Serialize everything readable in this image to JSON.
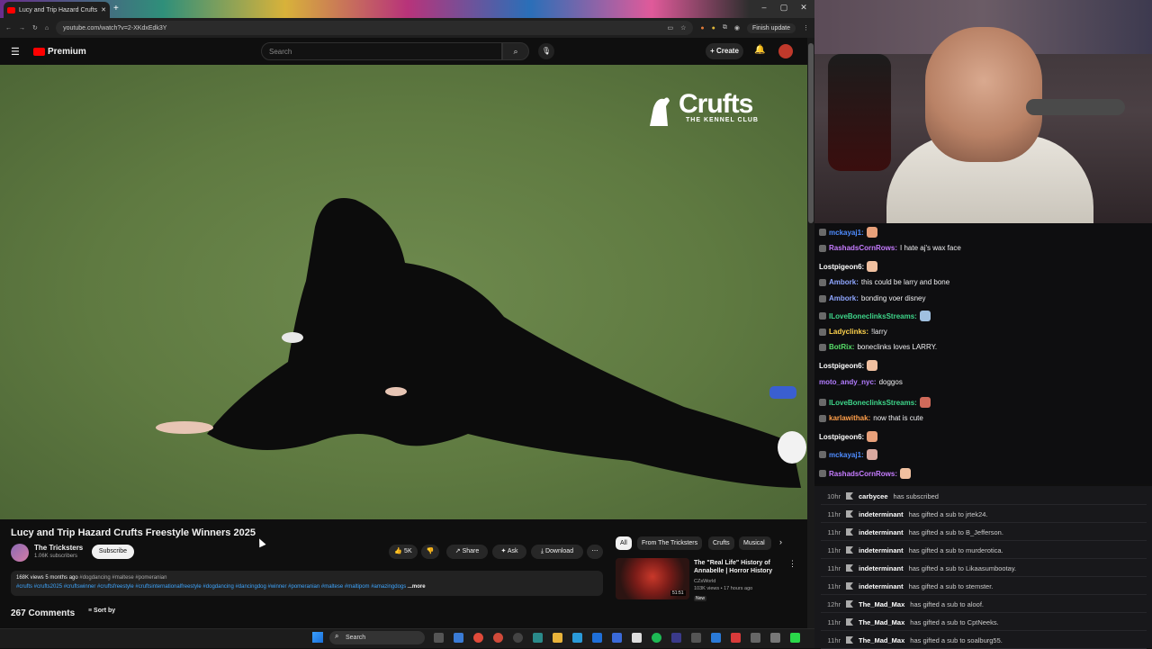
{
  "browser": {
    "tab_title": "Lucy and Trip Hazard Crufts",
    "url": "youtube.com/watch?v=2-XKdxEdk3Y",
    "finish_update": "Finish update"
  },
  "youtube": {
    "logo": "Premium",
    "search_placeholder": "Search",
    "create_label": "+ Create",
    "video": {
      "watermark_brand": "Crufts",
      "watermark_sub": "THE KENNEL CLUB",
      "title": "Lucy and Trip Hazard Crufts Freestyle Winners 2025",
      "channel": "The Tricksters",
      "subscribers": "1.06K subscribers",
      "subscribe_label": "Subscribe",
      "likes": "5K",
      "share_label": "Share",
      "ask_label": "Ask",
      "download_label": "Download",
      "desc_meta": "168K views  5 months ago  ",
      "desc_tags_1": "#dogdancing #maltese #pomeranian",
      "desc_tags_2": "#crufts #crufts2025 #cruftswinner #cruftsfreestyle #cruftsinternationalfreestyle #dogdancing #dancingdog #winner #pomeranian #maltese #maltipom #amazingdogs",
      "desc_more": "...more",
      "comments": "267 Comments",
      "sort_label": "Sort by"
    },
    "chips": [
      "All",
      "From The Tricksters",
      "Crufts",
      "Musical"
    ],
    "recommendation": {
      "title": "The \"Real Life\" History of Annabelle | Horror History",
      "channel": "CZsWorld",
      "meta": "103K views • 17 hours ago",
      "badge": "New",
      "duration": "51:51"
    }
  },
  "chat": [
    {
      "user": "mckayaj1:",
      "color": "#4e8cff",
      "text": ""
    },
    {
      "user": "RashadsCornRows:",
      "color": "#c67cff",
      "text": "I hate aj's wax face"
    },
    {
      "user": "Lostpigeon6:",
      "color": "#ffffff",
      "text": ""
    },
    {
      "user": "Ambork:",
      "color": "#8fa6ff",
      "text": "this could be larry and bone"
    },
    {
      "user": "Ambork:",
      "color": "#8fa6ff",
      "text": "bonding voer disney"
    },
    {
      "user": "ILoveBoneclinksStreams:",
      "color": "#3ed68a",
      "text": ""
    },
    {
      "user": "Ladyclinks:",
      "color": "#ffd34d",
      "text": "!larry"
    },
    {
      "user": "BotRix:",
      "color": "#58e06a",
      "text": "boneclinks loves LARRY."
    },
    {
      "user": "Lostpigeon6:",
      "color": "#ffffff",
      "text": ""
    },
    {
      "user": "moto_andy_nyc:",
      "color": "#b27cff",
      "text": "doggos"
    },
    {
      "user": "ILoveBoneclinksStreams:",
      "color": "#3ed68a",
      "text": ""
    },
    {
      "user": "karlawithak:",
      "color": "#ff9f4a",
      "text": "now that is cute"
    },
    {
      "user": "Lostpigeon6:",
      "color": "#ffffff",
      "text": ""
    },
    {
      "user": "mckayaj1:",
      "color": "#4e8cff",
      "text": ""
    },
    {
      "user": "RashadsCornRows:",
      "color": "#c67cff",
      "text": ""
    }
  ],
  "events": [
    {
      "time": "10hr",
      "user": "carbycee",
      "text": "has subscribed"
    },
    {
      "time": "11hr",
      "user": "indeterminant",
      "text": "has gifted a sub to jrtek24."
    },
    {
      "time": "11hr",
      "user": "indeterminant",
      "text": "has gifted a sub to B_Jefferson."
    },
    {
      "time": "11hr",
      "user": "indeterminant",
      "text": "has gifted a sub to murderotica."
    },
    {
      "time": "11hr",
      "user": "indeterminant",
      "text": "has gifted a sub to Likaasumbootay."
    },
    {
      "time": "11hr",
      "user": "indeterminant",
      "text": "has gifted a sub to stemster."
    },
    {
      "time": "12hr",
      "user": "The_Mad_Max",
      "text": "has gifted a sub to aloof."
    },
    {
      "time": "11hr",
      "user": "The_Mad_Max",
      "text": "has gifted a sub to CptNeeks."
    },
    {
      "time": "11hr",
      "user": "The_Mad_Max",
      "text": "has gifted a sub to soalburg55."
    }
  ],
  "taskbar": {
    "search": "Search"
  },
  "colors": {
    "yt_red": "#ff0000",
    "bg": "#0f0f0f",
    "chat_bg": "#0e0e10"
  }
}
